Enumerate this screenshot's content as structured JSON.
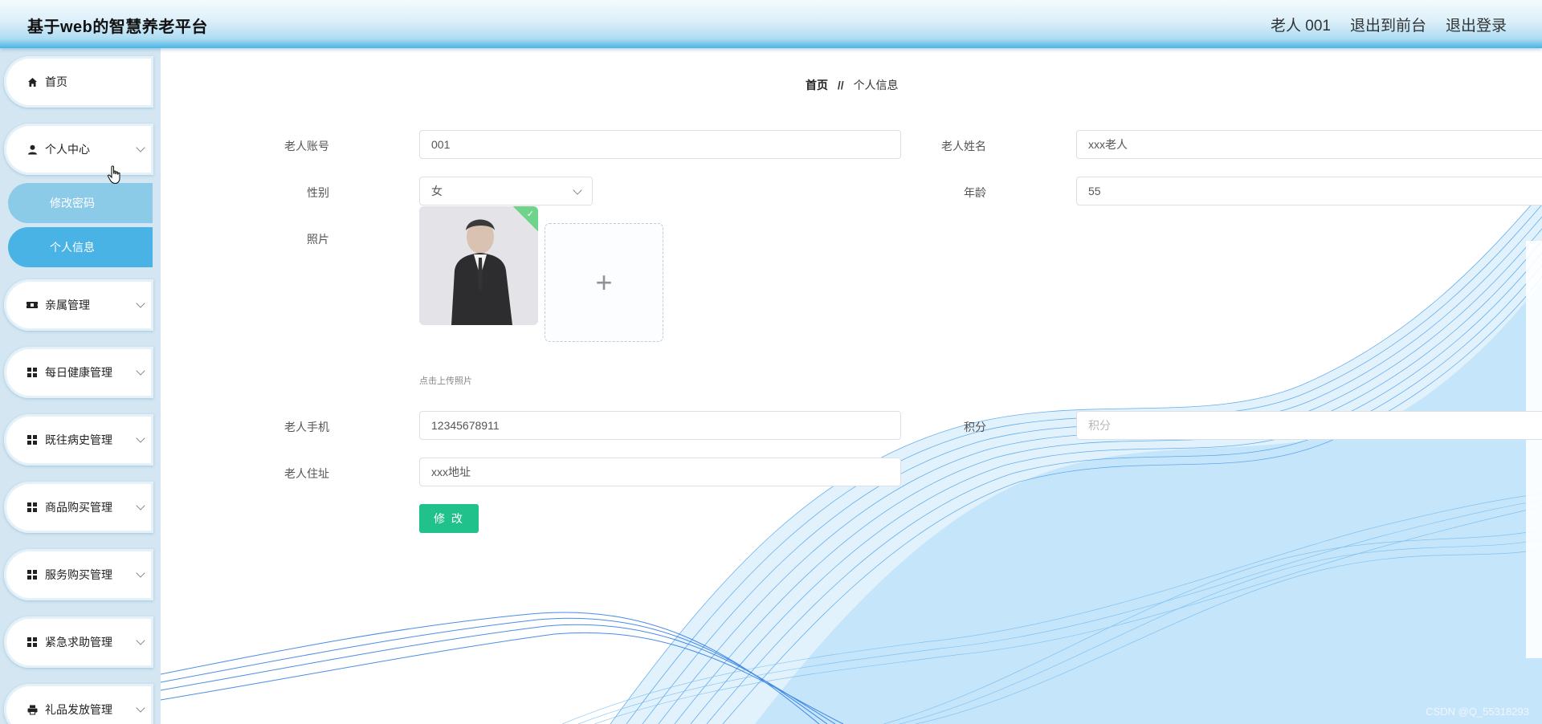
{
  "header": {
    "title": "基于web的智慧养老平台",
    "user": "老人 001",
    "front_link": "退出到前台",
    "logout_link": "退出登录"
  },
  "sidebar": {
    "items": [
      {
        "label": "首页",
        "icon": "home-icon"
      },
      {
        "label": "个人中心",
        "icon": "user-icon"
      },
      {
        "label": "亲属管理",
        "icon": "ticket-icon"
      },
      {
        "label": "每日健康管理",
        "icon": "grid-icon"
      },
      {
        "label": "既往病史管理",
        "icon": "grid-icon"
      },
      {
        "label": "商品购买管理",
        "icon": "grid-icon"
      },
      {
        "label": "服务购买管理",
        "icon": "grid-icon"
      },
      {
        "label": "紧急求助管理",
        "icon": "grid-icon"
      },
      {
        "label": "礼品发放管理",
        "icon": "printer-icon"
      }
    ],
    "subitems": [
      {
        "label": "修改密码"
      },
      {
        "label": "个人信息"
      }
    ]
  },
  "breadcrumb": {
    "home": "首页",
    "separator": "//",
    "current": "个人信息"
  },
  "form": {
    "account_label": "老人账号",
    "account_value": "001",
    "name_label": "老人姓名",
    "name_value": "xxx老人",
    "gender_label": "性别",
    "gender_value": "女",
    "age_label": "年龄",
    "age_value": "55",
    "photo_label": "照片",
    "upload_tip": "点击上传照片",
    "phone_label": "老人手机",
    "phone_value": "12345678911",
    "points_label": "积分",
    "points_placeholder": "积分",
    "address_label": "老人住址",
    "address_value": "xxx地址",
    "submit_label": "修 改"
  },
  "watermark": "CSDN @Q_55318293",
  "colors": {
    "accent": "#4ab3e6",
    "submenu_inactive": "#8ccbe8",
    "submit_button": "#21c18b",
    "sidebar_bg": "#d3e6f1"
  }
}
